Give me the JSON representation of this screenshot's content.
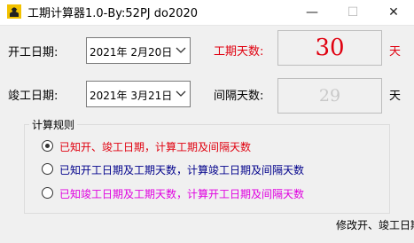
{
  "window": {
    "title": "工期计算器1.0-By:52PJ do2020",
    "controls": {
      "minimize": "—",
      "maximize": "☐",
      "close": "✕"
    }
  },
  "form": {
    "start_label": "开工日期:",
    "start_value": "2021年  2月20日",
    "end_label": "竣工日期:",
    "end_value": "2021年  3月21日"
  },
  "results": {
    "duration_label": "工期天数:",
    "duration_value": "30",
    "duration_unit": "天",
    "interval_label": "间隔天数:",
    "interval_value": "29",
    "interval_unit": "天"
  },
  "rules": {
    "title": "计算规则",
    "options": [
      {
        "label": "已知开、竣工日期，计算工期及间隔天数",
        "selected": true,
        "color": "#e0000f"
      },
      {
        "label": "已知开工日期及工期天数，计算竣工日期及间隔天数",
        "selected": false,
        "color": "#00008b"
      },
      {
        "label": "已知竣工日期及工期天数，计算开工日期及间隔天数",
        "selected": false,
        "color": "#e000e0"
      }
    ]
  },
  "status": {
    "text": "修改开、竣工日期"
  },
  "colors": {
    "duration_label": "#e0000f",
    "duration_value": "#e0000f",
    "duration_unit": "#e0000f",
    "interval_value": "#c8c8c8",
    "background": "#f0f0f0"
  },
  "icons": {
    "app": "construction-worker-icon",
    "dropdown": "chevron-down-icon"
  }
}
